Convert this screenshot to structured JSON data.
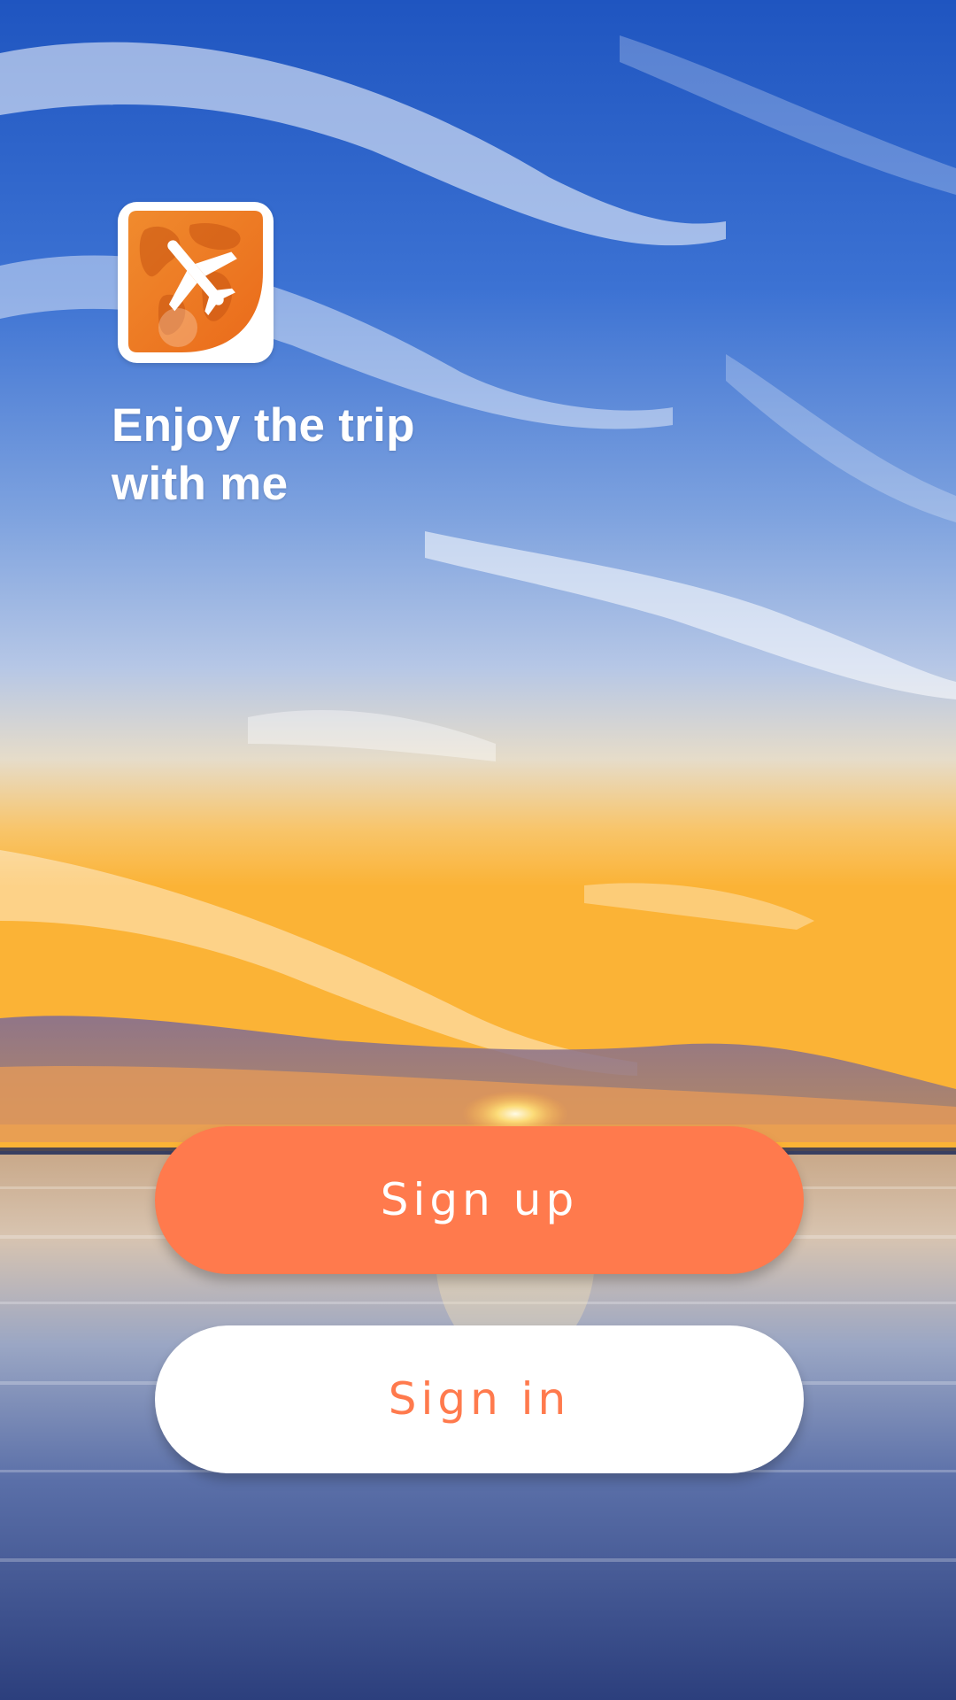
{
  "app": {
    "logo_icon": "airplane-globe-icon",
    "tagline_line1": "Enjoy the trip",
    "tagline_line2": "with me"
  },
  "actions": {
    "signup_label": "Sign up",
    "signin_label": "Sign in"
  },
  "colors": {
    "accent": "#FF7A4D",
    "logo_orange": "#F07A22",
    "button_light": "#FFFFFF"
  },
  "background": {
    "scene": "sunset-over-water-image"
  }
}
